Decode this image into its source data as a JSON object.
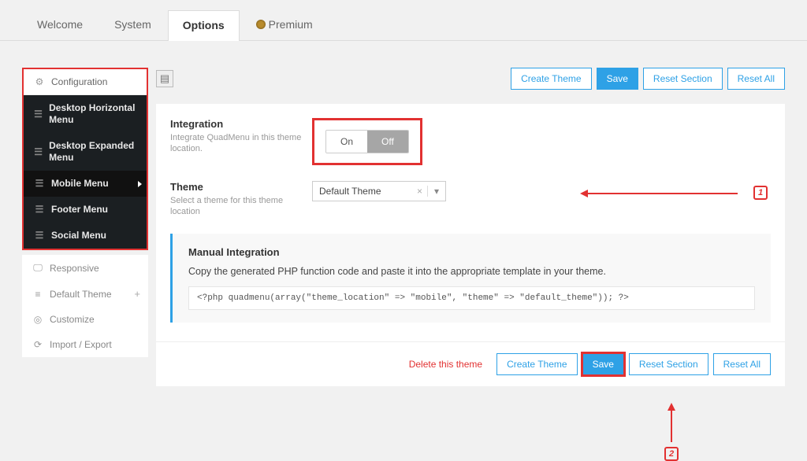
{
  "tabs": {
    "welcome": "Welcome",
    "system": "System",
    "options": "Options",
    "premium": "Premium"
  },
  "sidebar": {
    "config": "Configuration",
    "dark": [
      "Desktop Horizontal Menu",
      "Desktop Expanded Menu",
      "Mobile Menu",
      "Footer Menu",
      "Social Menu"
    ],
    "rest": [
      "Responsive",
      "Default Theme",
      "Customize",
      "Import / Export"
    ]
  },
  "buttons": {
    "create": "Create Theme",
    "save": "Save",
    "reset_section": "Reset Section",
    "reset_all": "Reset All",
    "delete": "Delete this theme"
  },
  "integration": {
    "title": "Integration",
    "desc": "Integrate QuadMenu in this theme location.",
    "on": "On",
    "off": "Off"
  },
  "theme_field": {
    "title": "Theme",
    "desc": "Select a theme for this theme location",
    "value": "Default Theme"
  },
  "manual": {
    "title": "Manual Integration",
    "desc": "Copy the generated PHP function code and paste it into the appropriate template in your theme.",
    "code": "<?php quadmenu(array(\"theme_location\" => \"mobile\", \"theme\" => \"default_theme\")); ?>"
  },
  "annot": {
    "n1": "1",
    "n2": "2"
  }
}
